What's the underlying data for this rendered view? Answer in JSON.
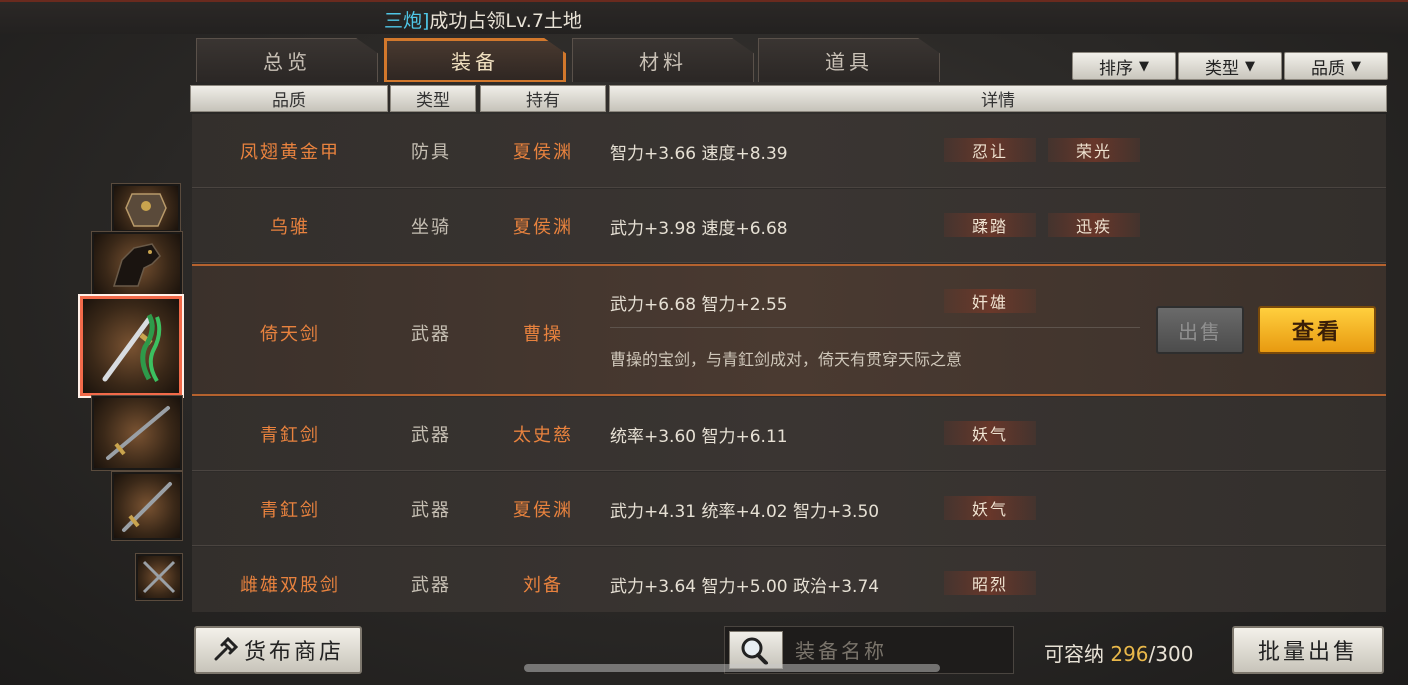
{
  "notice": {
    "highlight": "三炮]",
    "text": "成功占领Lv.7土地"
  },
  "tabs": [
    {
      "label": "总览",
      "active": false
    },
    {
      "label": "装备",
      "active": true
    },
    {
      "label": "材料",
      "active": false
    },
    {
      "label": "道具",
      "active": false
    }
  ],
  "filters": {
    "sort": "排序",
    "type": "类型",
    "quality": "品质",
    "arrow": "▼"
  },
  "columns": {
    "quality": "品质",
    "type": "类型",
    "holder": "持有",
    "details": "详情"
  },
  "rows": [
    {
      "name": "凤翅黄金甲",
      "type": "防具",
      "holder": "夏侯渊",
      "stats": "智力+3.66  速度+8.39",
      "tags": [
        "忍让",
        "荣光"
      ]
    },
    {
      "name": "乌骓",
      "type": "坐骑",
      "holder": "夏侯渊",
      "stats": "武力+3.98  速度+6.68",
      "tags": [
        "蹂踏",
        "迅疾"
      ]
    },
    {
      "name": "倚天剑",
      "type": "武器",
      "holder": "曹操",
      "stats": "武力+6.68  智力+2.55",
      "tags": [
        "奸雄"
      ],
      "desc": "曹操的宝剑，与青釭剑成对，倚天有贯穿天际之意",
      "selected": true
    },
    {
      "name": "青釭剑",
      "type": "武器",
      "holder": "太史慈",
      "stats": "统率+3.60  智力+6.11",
      "tags": [
        "妖气"
      ]
    },
    {
      "name": "青釭剑",
      "type": "武器",
      "holder": "夏侯渊",
      "stats": "武力+4.31  统率+4.02  智力+3.50",
      "tags": [
        "妖气"
      ]
    },
    {
      "name": "雌雄双股剑",
      "type": "武器",
      "holder": "刘备",
      "stats": "武力+3.64  智力+5.00  政治+3.74",
      "tags": [
        "昭烈"
      ]
    }
  ],
  "actions": {
    "sell": "出售",
    "view": "查看"
  },
  "bottom": {
    "shop_label": "货布商店",
    "search_placeholder": "装备名称",
    "capacity_label": "可容纳",
    "capacity_current": "296",
    "capacity_max": "/300",
    "bulk_sell": "批量出售"
  }
}
